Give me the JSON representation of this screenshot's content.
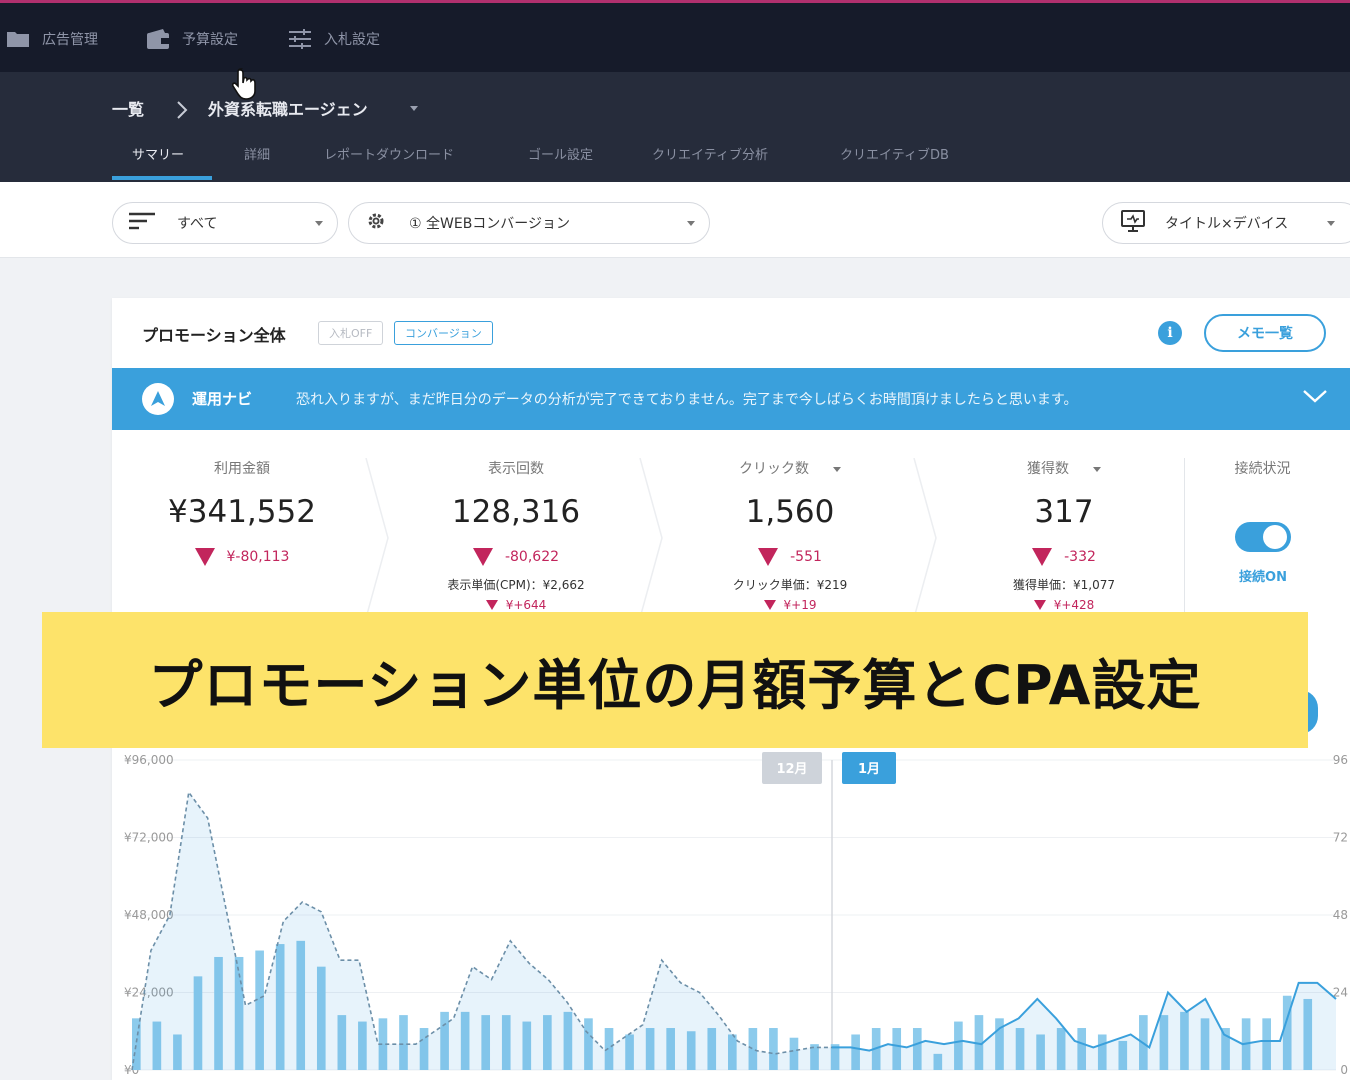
{
  "topnav": {
    "items": [
      {
        "label": "広告管理",
        "icon": "folder-icon"
      },
      {
        "label": "予算設定",
        "icon": "wallet-icon"
      },
      {
        "label": "入札設定",
        "icon": "sliders-icon"
      }
    ]
  },
  "breadcrumb": {
    "root": "一覧",
    "current": "外資系転職エージェン"
  },
  "tabs": [
    {
      "label": "サマリー",
      "active": true
    },
    {
      "label": "詳細"
    },
    {
      "label": "レポートダウンロード"
    },
    {
      "label": "ゴール設定"
    },
    {
      "label": "クリエイティブ分析"
    },
    {
      "label": "クリエイティブDB"
    }
  ],
  "filters": {
    "scope": "すべて",
    "conversion": "① 全WEBコンバージョン",
    "view": "タイトル×デバイス"
  },
  "card": {
    "title": "プロモーション全体",
    "tag_off": "入札OFF",
    "tag_cv": "コンバージョン",
    "info": "i",
    "memo_button": "メモ一覧"
  },
  "navi": {
    "label": "運用ナビ",
    "message": "恐れ入りますが、まだ昨日分のデータの分析が完了できておりません。完了まで今しばらくお時間頂けましたらと思います。"
  },
  "kpis": [
    {
      "label": "利用金額",
      "value": "¥341,552",
      "delta": "¥-80,113"
    },
    {
      "label": "表示回数",
      "value": "128,316",
      "delta": "-80,622",
      "sub": "表示単価(CPM)：¥2,662",
      "sub_delta": "¥+644"
    },
    {
      "label": "クリック数",
      "value": "1,560",
      "delta": "-551",
      "sub": "クリック単価：¥219",
      "sub_delta": "¥+19"
    },
    {
      "label": "獲得数",
      "value": "317",
      "delta": "-332",
      "sub": "獲得単価：¥1,077",
      "sub_delta": "¥+428"
    }
  ],
  "connection": {
    "label": "接続状況",
    "status": "接続ON"
  },
  "banner": {
    "text": "プロモーション単位の月額予算とCPA設定"
  },
  "colors": {
    "accent": "#3aa0dc",
    "negative": "#c2255c",
    "banner": "#fde36a",
    "topbar": "#161b2a",
    "subheader": "#262c3b"
  },
  "chart_data": {
    "type": "bar",
    "y_left_ticks": [
      "¥96,000",
      "¥72,000",
      "¥48,000",
      "¥24,000",
      "¥0"
    ],
    "y_right_ticks": [
      "96",
      "72",
      "48",
      "24",
      "0"
    ],
    "ylim_left": [
      0,
      96000
    ],
    "ylim_right": [
      0,
      96
    ],
    "month_labels": [
      "12月",
      "1月"
    ],
    "bars": [
      16000,
      15000,
      11000,
      29000,
      35000,
      35000,
      37000,
      39000,
      40000,
      32000,
      17000,
      15000,
      16000,
      17000,
      13000,
      18000,
      18000,
      17000,
      17000,
      15000,
      17000,
      18000,
      16000,
      13000,
      11000,
      13000,
      13000,
      12000,
      13000,
      11000,
      13000,
      13000,
      10000,
      8000,
      8000,
      11000,
      13000,
      13000,
      13000,
      5000,
      15000,
      17000,
      16000,
      13000,
      11000,
      13000,
      13000,
      11000,
      9000,
      17000,
      17000,
      18000,
      16000,
      13000,
      16000,
      16000,
      23000,
      22000
    ],
    "series": [
      {
        "name": "dashed",
        "values": [
          0,
          37000,
          48000,
          86000,
          78000,
          49000,
          20000,
          23000,
          46000,
          52000,
          49000,
          34000,
          34000,
          8000,
          8000,
          8000,
          12000,
          16000,
          32000,
          28000,
          40000,
          33000,
          28000,
          21000,
          12000,
          6000,
          10000,
          14000,
          34000,
          27000,
          24000,
          17000,
          9000,
          6000,
          5000,
          6000,
          7000,
          7000
        ]
      },
      {
        "name": "solid",
        "values": [
          7000,
          7000,
          6000,
          8000,
          7000,
          9000,
          8000,
          9000,
          8000,
          13000,
          16000,
          22000,
          16000,
          9000,
          7000,
          9000,
          11000,
          7000,
          24000,
          18000,
          22000,
          11000,
          8000,
          9000,
          9000,
          27000,
          27000,
          22000
        ]
      }
    ]
  }
}
